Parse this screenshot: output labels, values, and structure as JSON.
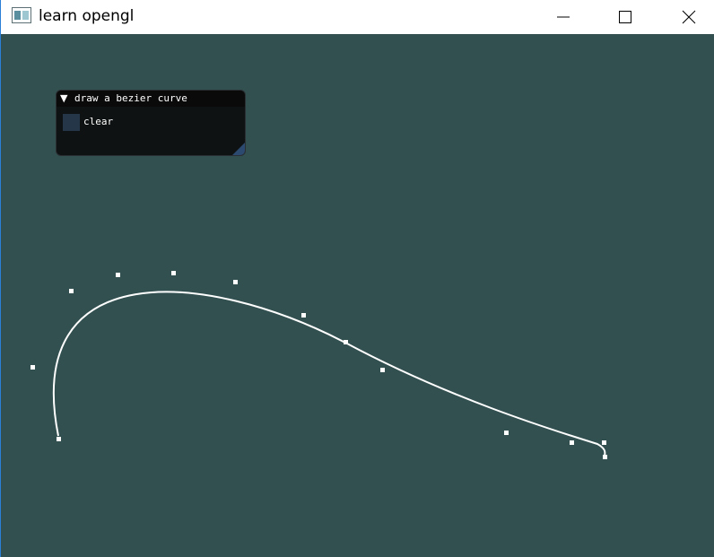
{
  "window": {
    "title": "learn opengl",
    "app_icon": "opengl-app-icon",
    "controls": [
      "minimize-icon",
      "maximize-icon",
      "close-icon"
    ]
  },
  "colors": {
    "viewport_bg": "#335050",
    "curve": "#ffffff",
    "control_point": "#ffffff",
    "panel_bg": "#0f1212",
    "checkbox_bg": "#253649"
  },
  "panel": {
    "collapse_arrow": "▼",
    "title": "draw a bezier curve",
    "checkbox_label": "clear",
    "checkbox_checked": false
  },
  "control_points_count": 13
}
